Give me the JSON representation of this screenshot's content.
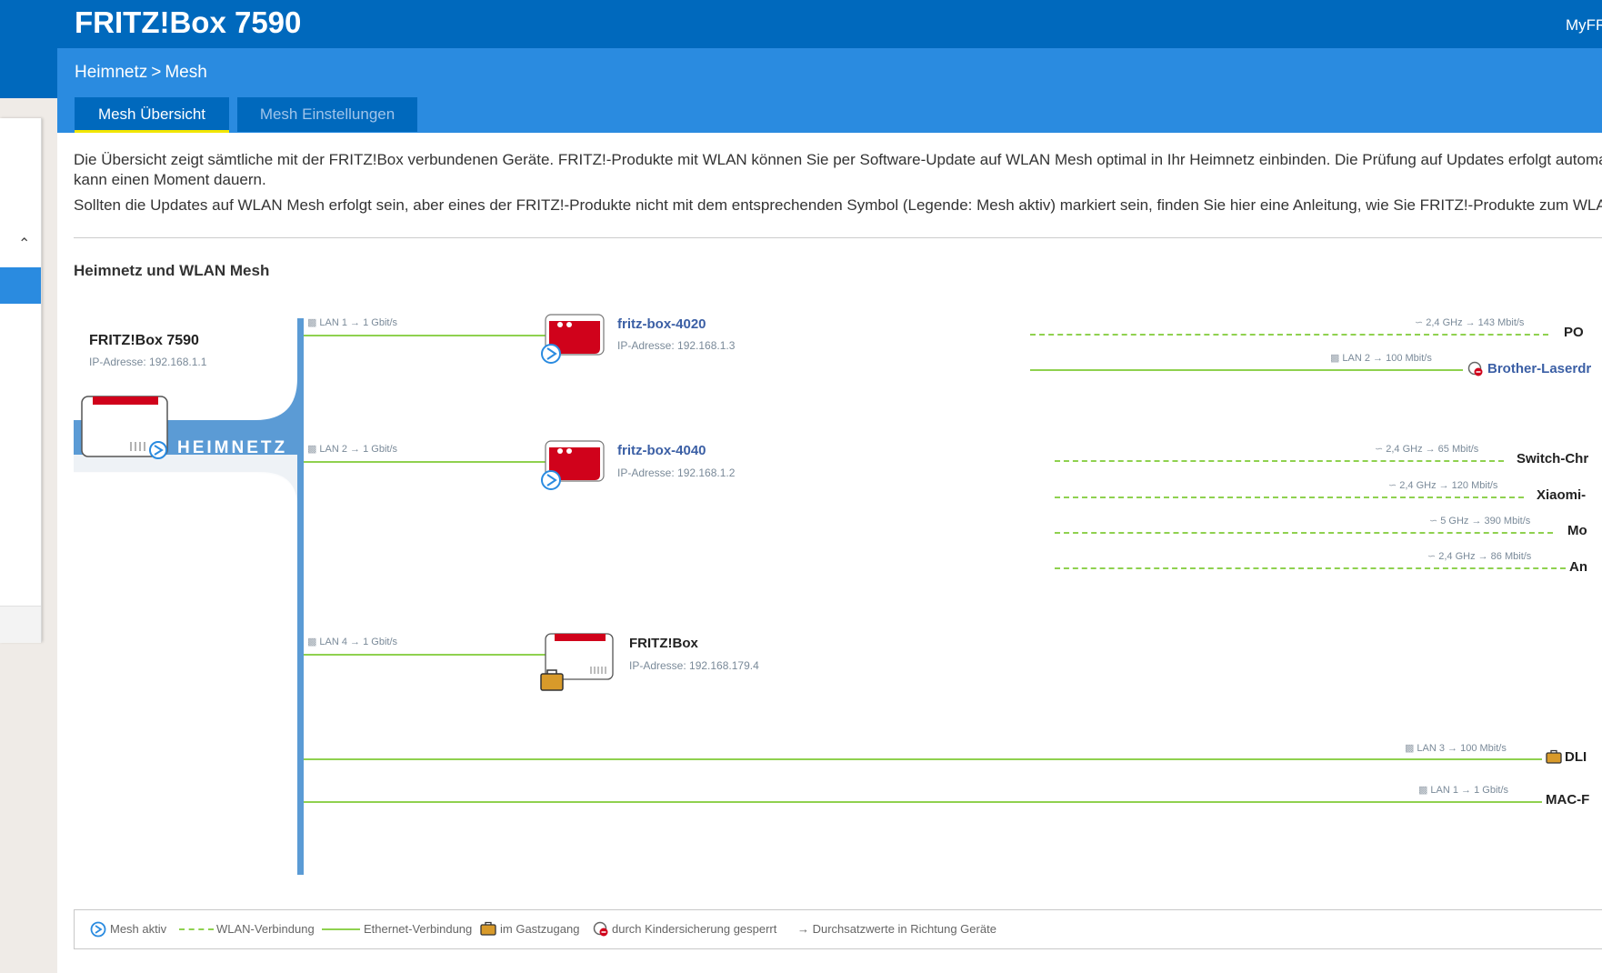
{
  "header": {
    "title": "FRITZ!Box 7590",
    "myfritz": "MyFR"
  },
  "breadcrumb": {
    "parent": "Heimnetz",
    "separator": ">",
    "current": "Mesh"
  },
  "tabs": [
    {
      "label": "Mesh Übersicht",
      "active": true
    },
    {
      "label": "Mesh Einstellungen",
      "active": false
    }
  ],
  "intro": {
    "line1": "Die Übersicht zeigt sämtliche mit der FRITZ!Box verbundenen Geräte. FRITZ!-Produkte mit WLAN können Sie per Software-Update auf WLAN Mesh optimal in Ihr Heimnetz einbinden. Die Prüfung auf Updates erfolgt automatisch",
    "line2": "kann einen Moment dauern.",
    "line3": "Sollten die Updates auf WLAN Mesh erfolgt sein, aber eines der FRITZ!-Produkte nicht mit dem entsprechenden Symbol (Legende: Mesh aktiv) markiert sein, finden Sie hier eine Anleitung, wie Sie FRITZ!-Produkte zum WLAN Mesh"
  },
  "section_title": "Heimnetz und WLAN Mesh",
  "root": {
    "name": "FRITZ!Box 7590",
    "ip": "IP-Adresse: 192.168.1.1",
    "badge": "HEIMNETZ"
  },
  "links": {
    "l1": "LAN 1 → 1 Gbit/s",
    "l2": "LAN 2 → 1 Gbit/s",
    "l3": "LAN 4 → 1 Gbit/s"
  },
  "devices": {
    "d1": {
      "name": "fritz-box-4020",
      "ip": "IP-Adresse: 192.168.1.3"
    },
    "d2": {
      "name": "fritz-box-4040",
      "ip": "IP-Adresse: 192.168.1.2"
    },
    "d3": {
      "name": "FRITZ!Box",
      "ip": "IP-Adresse: 192.168.179.4"
    }
  },
  "clients": {
    "c1": {
      "label": "2,4 GHz → 143 Mbit/s",
      "name": "PO"
    },
    "c2": {
      "label": "LAN 2 → 100 Mbit/s",
      "name": "Brother-Laserdr"
    },
    "c3": {
      "label": "2,4 GHz → 65 Mbit/s",
      "name": "Switch-Chr"
    },
    "c4": {
      "label": "2,4 GHz → 120 Mbit/s",
      "name": "Xiaomi-"
    },
    "c5": {
      "label": "5 GHz → 390 Mbit/s",
      "name": "Mo"
    },
    "c6": {
      "label": "2,4 GHz → 86 Mbit/s",
      "name": "An"
    },
    "c7": {
      "label": "LAN 3 → 100 Mbit/s",
      "name": "DLI"
    },
    "c8": {
      "label": "LAN 1 → 1 Gbit/s",
      "name": "MAC-F"
    }
  },
  "legend": {
    "mesh": "Mesh aktiv",
    "wlan": "WLAN-Verbindung",
    "eth": "Ethernet-Verbindung",
    "guest": "im Gastzugang",
    "kids": "durch Kindersicherung gesperrt",
    "throughput": "→ Durchsatzwerte in Richtung Geräte"
  },
  "colors": {
    "brand": "#0069bd",
    "accent": "#2a8be0",
    "link": "#8fd14f",
    "bus": "#5b9bd5",
    "fritz_red": "#d0021b",
    "guest": "#d89a2a"
  }
}
